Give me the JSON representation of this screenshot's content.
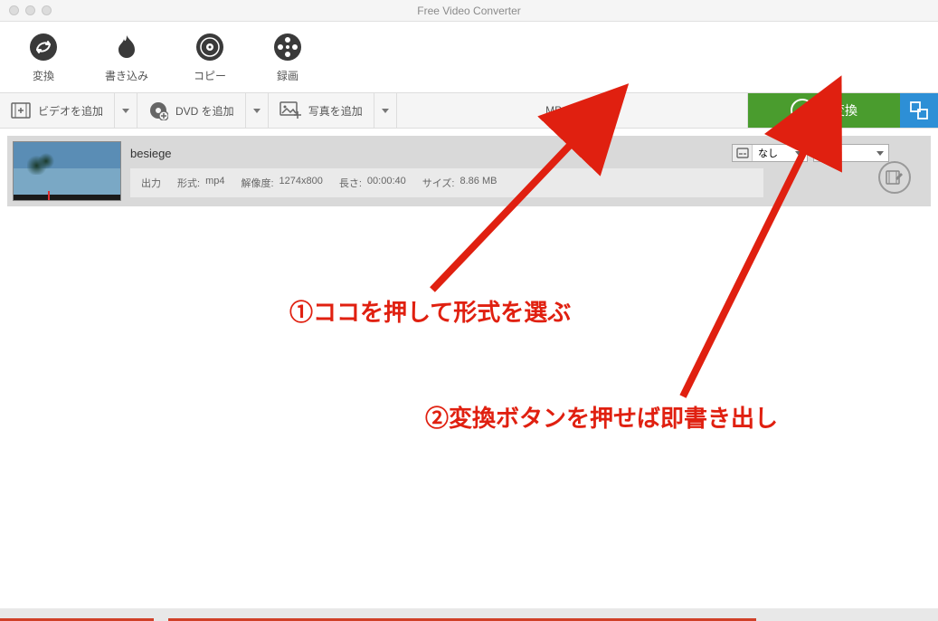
{
  "window": {
    "title": "Free Video Converter"
  },
  "tabs": {
    "convert": "変換",
    "burn": "書き込み",
    "copy": "コピー",
    "record": "録画"
  },
  "toolbar": {
    "add_video": "ビデオを追加",
    "add_dvd": "DVD を追加",
    "add_photo": "写真を追加",
    "format_selected": "MP4 Video",
    "convert_label": "変換"
  },
  "item": {
    "name": "besiege",
    "subtitle_select": "なし",
    "audio_select": "",
    "output_label": "出力",
    "format_label": "形式:",
    "format_value": "mp4",
    "resolution_label": "解像度:",
    "resolution_value": "1274x800",
    "length_label": "長さ:",
    "length_value": "00:00:40",
    "size_label": "サイズ:",
    "size_value": "8.86 MB"
  },
  "annotations": {
    "step1": "①ココを押して形式を選ぶ",
    "step2": "②変換ボタンを押せば即書き出し"
  }
}
